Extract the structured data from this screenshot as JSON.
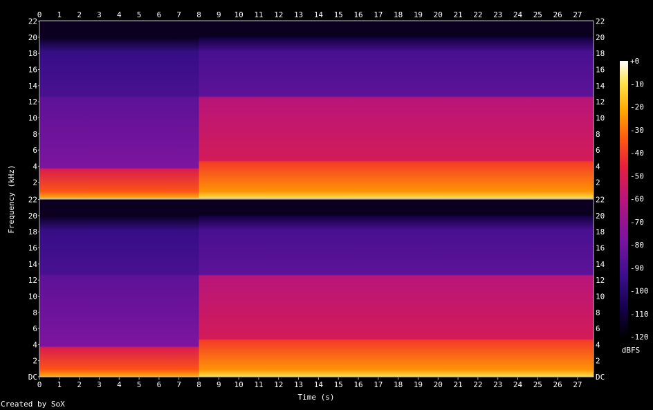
{
  "chart_data": {
    "type": "heatmap",
    "title": "",
    "xlabel": "Time (s)",
    "ylabel": "Frequency (kHz)",
    "x_ticks": [
      "0",
      "1",
      "2",
      "3",
      "4",
      "5",
      "6",
      "7",
      "8",
      "9",
      "10",
      "11",
      "12",
      "13",
      "14",
      "15",
      "16",
      "17",
      "18",
      "19",
      "20",
      "21",
      "22",
      "23",
      "24",
      "25",
      "26",
      "27"
    ],
    "xlim": [
      0,
      27.8
    ],
    "channels": [
      {
        "y_ticks": [
          "22",
          "20",
          "18",
          "16",
          "14",
          "12",
          "10",
          "8",
          "6",
          "4",
          "2"
        ]
      },
      {
        "y_ticks": [
          "22",
          "20",
          "18",
          "16",
          "14",
          "12",
          "10",
          "8",
          "6",
          "4",
          "2",
          "DC"
        ]
      }
    ],
    "ylim_khz": [
      0,
      22.05
    ],
    "colorbar": {
      "label": "dBFS",
      "ticks": [
        "+0",
        "-10",
        "-20",
        "-30",
        "-40",
        "-50",
        "-60",
        "-70",
        "-80",
        "-90",
        "-100",
        "-110",
        "-120"
      ],
      "range": [
        -120,
        0
      ],
      "colors": [
        "#000000",
        "#14004a",
        "#3a0f8c",
        "#7a14a0",
        "#b8157a",
        "#e8203c",
        "#ff5a10",
        "#ffa800",
        "#ffe24a",
        "#ffffff"
      ]
    },
    "segments": [
      {
        "start_s": 0,
        "end_s": 8,
        "description_levels_db": {
          "above_14khz": -95,
          "4_to_14khz": -85,
          "below_4khz": -45
        }
      },
      {
        "start_s": 8,
        "end_s": 27.8,
        "description_levels_db": {
          "above_14khz": -90,
          "5_to_14khz": -60,
          "below_5khz": -35
        }
      }
    ]
  },
  "footer": {
    "credit": "Created by SoX"
  }
}
